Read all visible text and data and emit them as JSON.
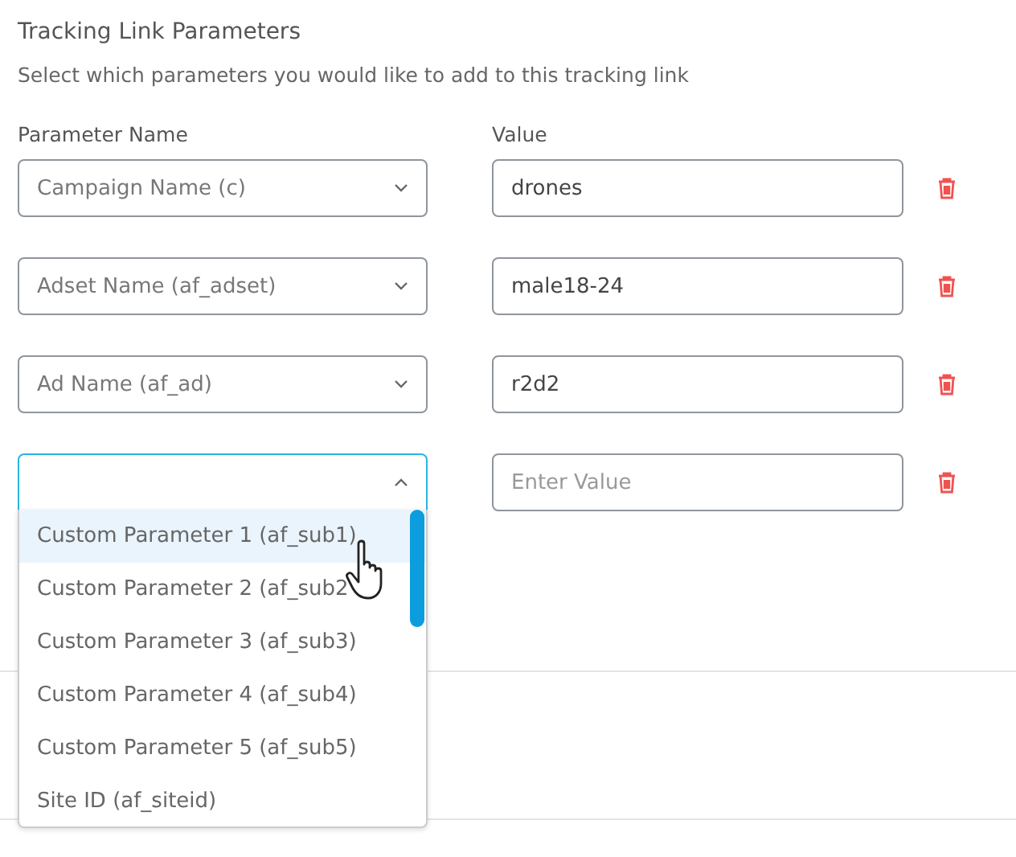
{
  "section": {
    "title": "Tracking Link Parameters",
    "subtitle": "Select which parameters you would like to add to this tracking link"
  },
  "columns": {
    "name": "Parameter Name",
    "value": "Value"
  },
  "rows": [
    {
      "parameter": "Campaign Name (c)",
      "value": "drones",
      "expanded": false
    },
    {
      "parameter": "Adset Name (af_adset)",
      "value": "male18-24",
      "expanded": false
    },
    {
      "parameter": "Ad Name (af_ad)",
      "value": "r2d2",
      "expanded": false
    },
    {
      "placeholder": "Enter Value",
      "expanded": true,
      "options": [
        {
          "label": "Custom Parameter 1 (af_sub1)",
          "selected": true
        },
        {
          "label": "Custom Parameter 2 (af_sub2",
          "selected": false
        },
        {
          "label": "Custom Parameter 3 (af_sub3)",
          "selected": false
        },
        {
          "label": "Custom Parameter 4 (af_sub4)",
          "selected": false
        },
        {
          "label": "Custom Parameter 5 (af_sub5)",
          "selected": false
        },
        {
          "label": "Site ID (af_siteid)",
          "selected": false
        }
      ]
    }
  ]
}
